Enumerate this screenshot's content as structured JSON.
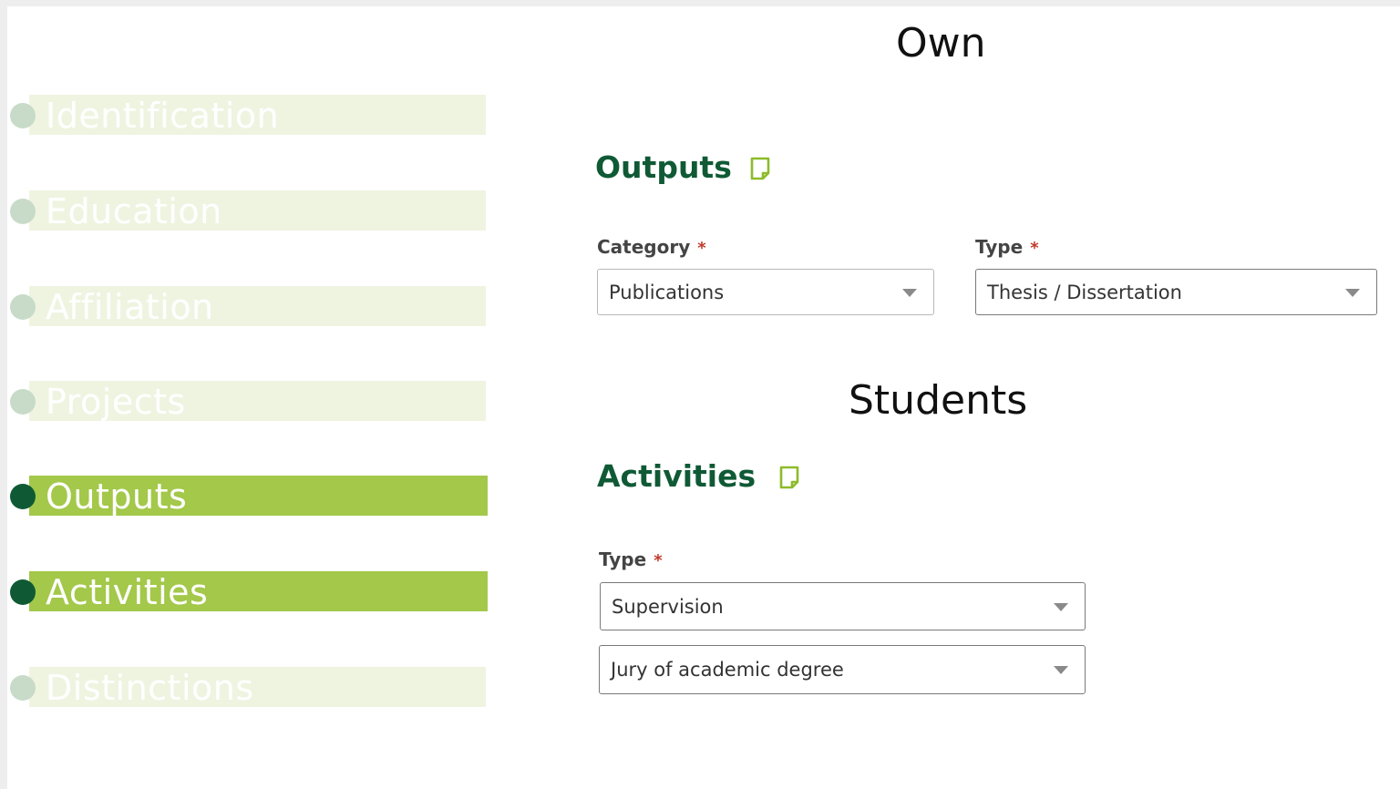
{
  "sidebar": {
    "items": [
      {
        "label": "Identification",
        "active": false
      },
      {
        "label": "Education",
        "active": false
      },
      {
        "label": "Affiliation",
        "active": false
      },
      {
        "label": "Projects",
        "active": false
      },
      {
        "label": "Outputs",
        "active": true
      },
      {
        "label": "Activities",
        "active": true
      },
      {
        "label": "Distinctions",
        "active": false
      }
    ]
  },
  "own": {
    "caption": "Own",
    "heading": "Outputs",
    "category_label": "Category",
    "category_value": "Publications",
    "type_label": "Type",
    "type_value": "Thesis / Dissertation",
    "required_mark": "*"
  },
  "students": {
    "caption": "Students",
    "heading": "Activities",
    "type_label": "Type",
    "type_value": "Supervision",
    "subtype_value": "Jury of academic degree",
    "required_mark": "*"
  },
  "colors": {
    "brand_green": "#0f5a35",
    "active_bar": "#a3c84a",
    "inactive_bar": "#eff4e1",
    "note_icon": "#8dbb2b"
  },
  "icons": {
    "note": "note-icon",
    "dropdown": "chevron-down-icon"
  }
}
